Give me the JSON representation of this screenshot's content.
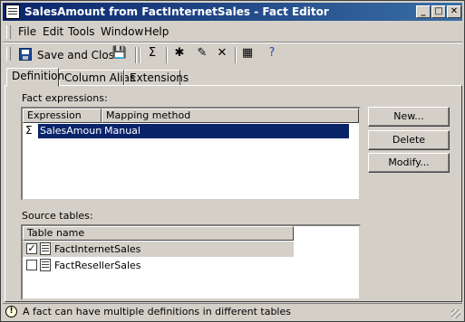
{
  "window": {
    "title": "SalesAmount from FactInternetSales - Fact Editor"
  },
  "titlebar_buttons": [
    "_",
    "□",
    "✕"
  ],
  "menu": [
    "File",
    "Edit",
    "Tools",
    "Window",
    "Help"
  ],
  "toolbar": {
    "save_close_label": "Save and Close"
  },
  "tabs": [
    "Definition",
    "Column Alias",
    "Extensions"
  ],
  "fact_expressions": {
    "label": "Fact expressions:",
    "columns": [
      "Expression",
      "Mapping method"
    ],
    "rows": [
      {
        "expression": "SalesAmount",
        "mapping": "Manual",
        "icon": "sigma-icon"
      }
    ]
  },
  "buttons": {
    "new": "New...",
    "delete": "Delete",
    "modify": "Modify..."
  },
  "source_tables": {
    "label": "Source tables:",
    "column": "Table name",
    "rows": [
      {
        "name": "FactInternetSales",
        "checked": true,
        "check": "✓"
      },
      {
        "name": "FactResellerSales",
        "checked": false,
        "check": ""
      }
    ]
  },
  "status": {
    "text": "A fact can have multiple definitions in different tables"
  },
  "colors": {
    "title_start": "#0a246a",
    "title_end": "#3a6ea5",
    "selection": "#0a246a",
    "face": "#d4d0c8"
  }
}
